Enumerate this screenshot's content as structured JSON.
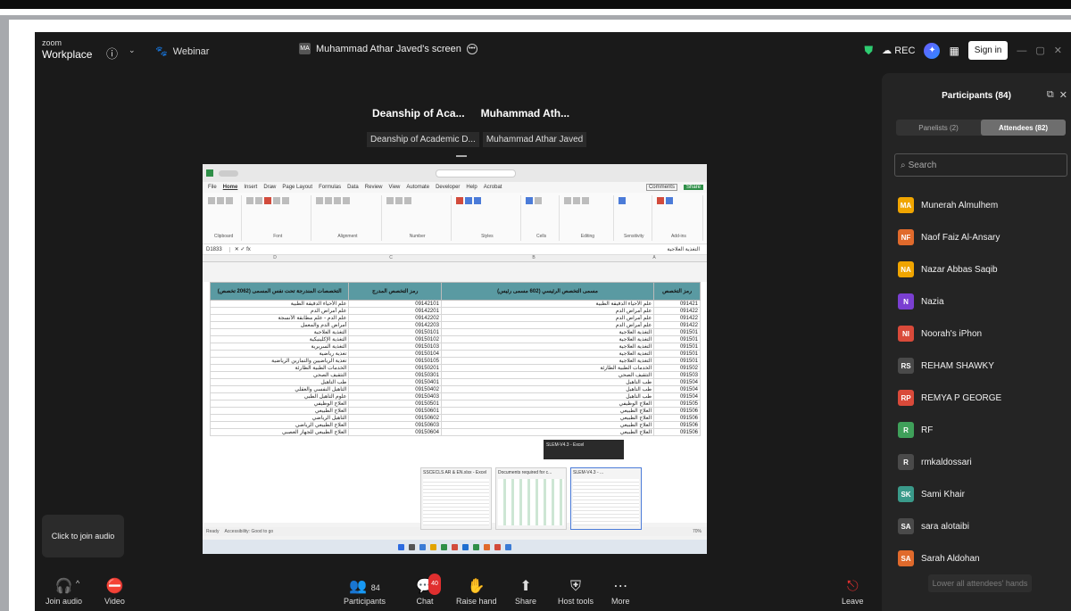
{
  "app": {
    "brand_top": "zoom",
    "brand_main": "Workplace",
    "webinar_label": "Webinar",
    "screen_owner_initials": "MA",
    "screen_owner_label": "Muhammad Athar Javed's screen",
    "rec_label": "REC",
    "signin_label": "Sign in"
  },
  "video_tiles": {
    "names_short": [
      "Deanship of Aca...",
      "Muhammad Ath..."
    ],
    "names_full": [
      "Deanship of Academic D...",
      "Muhammad Athar Javed"
    ]
  },
  "excel": {
    "menu": [
      "File",
      "Home",
      "Insert",
      "Draw",
      "Page Layout",
      "Formulas",
      "Data",
      "Review",
      "View",
      "Automate",
      "Developer",
      "Help",
      "Acrobat"
    ],
    "cell_ref": "D1833",
    "comments_label": "Comments",
    "share_label": "Share",
    "ribbon_groups": [
      "Clipboard",
      "Font",
      "Alignment",
      "Number",
      "Styles",
      "Cells",
      "Editing",
      "Sensitivity",
      "Add-ins"
    ],
    "col_letters": [
      "D",
      "C",
      "B",
      "A"
    ],
    "headers": [
      "التخصصات المندرجة تحت نفس المسمى (2062 تخصص)",
      "رمز التخصص المدرج",
      "مسمى التخصص الرئيسي (602 مسمى رئيس)",
      "رمز التخصص"
    ],
    "rows": [
      [
        "علم الأحياء الدقيقة الطبية",
        "09142101",
        "علم الأحياء الدقيقة الطبية",
        "091421"
      ],
      [
        "علم أمراض الدم",
        "09142201",
        "علم أمراض الدم",
        "091422"
      ],
      [
        "علم الدم - علم مطابقة الأنسجة",
        "09142202",
        "علم أمراض الدم",
        "091422"
      ],
      [
        "أمراض الدم والمعمل",
        "09142203",
        "علم أمراض الدم",
        "091422"
      ],
      [
        "التغذية العلاجية",
        "09150101",
        "التغذية العلاجية",
        "091501"
      ],
      [
        "التغذية الإكلينيكية",
        "09150102",
        "التغذية العلاجية",
        "091501"
      ],
      [
        "التغذية السريرية",
        "09150103",
        "التغذية العلاجية",
        "091501"
      ],
      [
        "تغذية رياضية",
        "09150104",
        "التغذية العلاجية",
        "091501"
      ],
      [
        "تغذية الرياضيين والتمارين الرياضية",
        "09150105",
        "التغذية العلاجية",
        "091501"
      ],
      [
        "الخدمات الطبية الطارئة",
        "09150201",
        "الخدمات الطبية الطارئة",
        "091502"
      ],
      [
        "التثقيف الصحي",
        "09150301",
        "التثقيف الصحي",
        "091503"
      ],
      [
        "طب التأهيل",
        "09150401",
        "طب التأهيل",
        "091504"
      ],
      [
        "التأهيل النفسي والعقلي",
        "09150402",
        "طب التأهيل",
        "091504"
      ],
      [
        "علوم التأهيل الطبي",
        "09150403",
        "طب التأهيل",
        "091504"
      ],
      [
        "العلاج الوظيفي",
        "09150501",
        "العلاج الوظيفي",
        "091505"
      ],
      [
        "العلاج الطبيعي",
        "09150601",
        "العلاج الطبيعي",
        "091506"
      ],
      [
        "التأهيل الرياضي",
        "09150602",
        "العلاج الطبيعي",
        "091506"
      ],
      [
        "العلاج الطبيعي الرياضي",
        "09150603",
        "العلاج الطبيعي",
        "091506"
      ],
      [
        "العلاج الطبيعي للجهاز العصبي",
        "09150604",
        "العلاج الطبيعي",
        "091506"
      ]
    ],
    "status_left": "Ready",
    "status_access": "Accessibility: Good to go",
    "zoom_pct": "70%",
    "thumbnails": [
      "SSCECLS AR & EN.xlsx - Excel",
      "Documents required for c...",
      "SLEM-V4.3 - ..."
    ],
    "tooltip": "SLEM-V4.3 - Excel"
  },
  "toolbar": {
    "join_audio": "Join audio",
    "video": "Video",
    "participants": "Participants",
    "participants_count": "84",
    "chat": "Chat",
    "chat_badge": "40",
    "raise_hand": "Raise hand",
    "share": "Share",
    "host_tools": "Host tools",
    "more": "More",
    "leave": "Leave",
    "join_audio_tip": "Click to join audio"
  },
  "participants_panel": {
    "title": "Participants (84)",
    "tab_panelists": "Panelists (2)",
    "tab_attendees": "Attendees (82)",
    "search_placeholder": "Search",
    "attendees": [
      {
        "initials": "MA",
        "name": "Munerah Almulhem",
        "color": "#f0a500"
      },
      {
        "initials": "NF",
        "name": "Naof Faiz Al-Ansary",
        "color": "#e06a2c"
      },
      {
        "initials": "NA",
        "name": "Nazar Abbas Saqib",
        "color": "#f0a500"
      },
      {
        "initials": "N",
        "name": "Nazia",
        "color": "#7a3fd1"
      },
      {
        "initials": "NI",
        "name": "Noorah's iPhon",
        "color": "#d94a3a"
      },
      {
        "initials": "RS",
        "name": "REHAM SHAWKY",
        "color": "#4a4a4a"
      },
      {
        "initials": "RP",
        "name": "REMYA P GEORGE",
        "color": "#d94a3a"
      },
      {
        "initials": "R",
        "name": "RF",
        "color": "#3fa05a"
      },
      {
        "initials": "R",
        "name": "rmkaldossari",
        "color": "#4a4a4a"
      },
      {
        "initials": "SK",
        "name": "Sami Khair",
        "color": "#3a9a8a"
      },
      {
        "initials": "SA",
        "name": "sara alotaibi",
        "color": "#4a4a4a"
      },
      {
        "initials": "SA",
        "name": "Sarah Aldohan",
        "color": "#e06a2c"
      }
    ],
    "lower_hands": "Lower all attendees' hands"
  }
}
